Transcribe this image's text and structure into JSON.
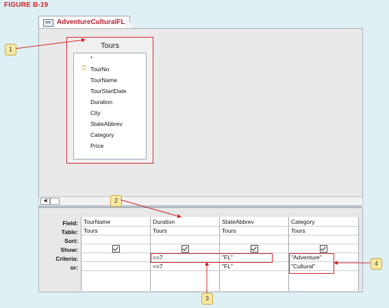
{
  "figure_label": "FIGURE B-19",
  "tab": {
    "title": "AdventureCulturalFL",
    "icon": "query-icon"
  },
  "table": {
    "name": "Tours",
    "fields": [
      "*",
      "TourNo",
      "TourName",
      "TourStartDate",
      "Duration",
      "City",
      "StateAbbrev",
      "Category",
      "Price"
    ],
    "primary_key": "TourNo"
  },
  "grid": {
    "row_labels": [
      "Field:",
      "Table:",
      "Sort:",
      "Show:",
      "Criteria:",
      "or:"
    ],
    "columns": [
      {
        "field": "TourName",
        "table": "Tours",
        "show": true,
        "criteria": "",
        "or": ""
      },
      {
        "field": "Duration",
        "table": "Tours",
        "show": true,
        "criteria": "<=7",
        "or": "<=7"
      },
      {
        "field": "StateAbbrev",
        "table": "Tours",
        "show": true,
        "criteria": "\"FL\"",
        "or": "\"FL\""
      },
      {
        "field": "Category",
        "table": "Tours",
        "show": true,
        "criteria": "\"Adventure\"",
        "or": "\"Cultural\""
      }
    ]
  },
  "callouts": [
    "1",
    "2",
    "3",
    "4"
  ],
  "colors": {
    "accent": "#d2232a",
    "callout_fill": "#f7e9a2",
    "background": "#dff0f4"
  }
}
